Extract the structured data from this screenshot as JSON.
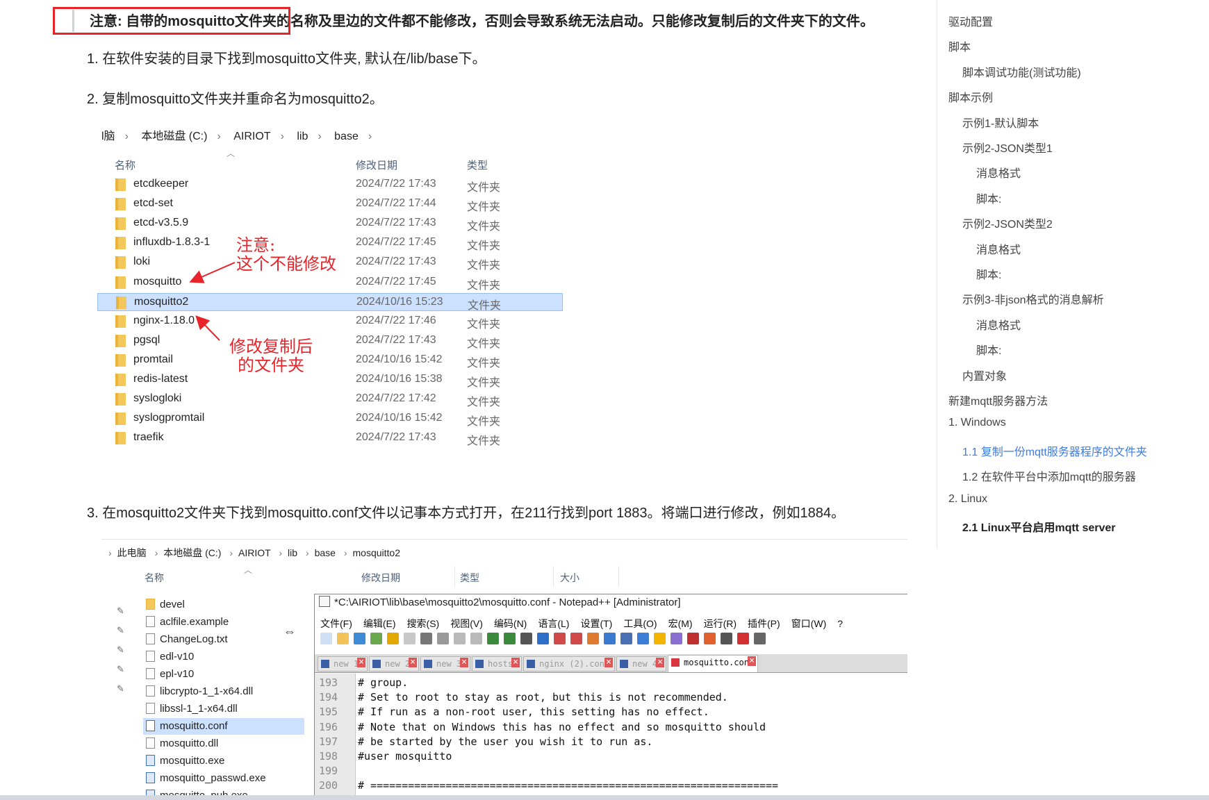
{
  "article": {
    "note": "注意: 自带的mosquitto文件夹的名称及里边的文件都不能修改，否则会导致系统无法启动。只能修改复制后的文件夹下的文件。",
    "step1": "1. 在软件安装的目录下找到mosquitto文件夹, 默认在/lib/base下。",
    "step2": "2. 复制mosquitto文件夹并重命名为mosquitto2。",
    "step3": "3. 在mosquitto2文件夹下找到mosquitto.conf文件以记事本方式打开，在211行找到port 1883。将端口进行修改，例如1884。"
  },
  "explorer1": {
    "breadcrumb": [
      "l脑",
      "本地磁盘 (C:)",
      "AIRIOT",
      "lib",
      "base"
    ],
    "headers": {
      "name": "名称",
      "date": "修改日期",
      "type": "类型"
    },
    "files": [
      {
        "name": "etcdkeeper",
        "date": "2024/7/22 17:43",
        "type": "文件夹"
      },
      {
        "name": "etcd-set",
        "date": "2024/7/22 17:44",
        "type": "文件夹"
      },
      {
        "name": "etcd-v3.5.9",
        "date": "2024/7/22 17:43",
        "type": "文件夹"
      },
      {
        "name": "influxdb-1.8.3-1",
        "date": "2024/7/22 17:45",
        "type": "文件夹"
      },
      {
        "name": "loki",
        "date": "2024/7/22 17:43",
        "type": "文件夹"
      },
      {
        "name": "mosquitto",
        "date": "2024/7/22 17:45",
        "type": "文件夹"
      },
      {
        "name": "mosquitto2",
        "date": "2024/10/16 15:23",
        "type": "文件夹"
      },
      {
        "name": "nginx-1.18.0",
        "date": "2024/7/22 17:46",
        "type": "文件夹"
      },
      {
        "name": "pgsql",
        "date": "2024/7/22 17:43",
        "type": "文件夹"
      },
      {
        "name": "promtail",
        "date": "2024/10/16 15:42",
        "type": "文件夹"
      },
      {
        "name": "redis-latest",
        "date": "2024/10/16 15:38",
        "type": "文件夹"
      },
      {
        "name": "syslogloki",
        "date": "2024/7/22 17:42",
        "type": "文件夹"
      },
      {
        "name": "syslogpromtail",
        "date": "2024/10/16 15:42",
        "type": "文件夹"
      },
      {
        "name": "traefik",
        "date": "2024/7/22 17:43",
        "type": "文件夹"
      }
    ],
    "annotation1": [
      "注意:",
      "这个不能修改"
    ],
    "annotation2": [
      "修改复制后",
      "的文件夹"
    ]
  },
  "explorer2": {
    "breadcrumb": [
      "此电脑",
      "本地磁盘 (C:)",
      "AIRIOT",
      "lib",
      "base",
      "mosquitto2"
    ],
    "headers": {
      "name": "名称",
      "date": "修改日期",
      "type": "类型",
      "size": "大小"
    },
    "files": [
      {
        "name": "devel",
        "icon": "folder-icon"
      },
      {
        "name": "aclfile.example",
        "icon": "file-icon"
      },
      {
        "name": "ChangeLog.txt",
        "icon": "text-file-icon"
      },
      {
        "name": "edl-v10",
        "icon": "file-icon"
      },
      {
        "name": "epl-v10",
        "icon": "file-icon"
      },
      {
        "name": "libcrypto-1_1-x64.dll",
        "icon": "dll-icon"
      },
      {
        "name": "libssl-1_1-x64.dll",
        "icon": "dll-icon"
      },
      {
        "name": "mosquitto.conf",
        "icon": "conf-icon"
      },
      {
        "name": "mosquitto.dll",
        "icon": "dll-icon"
      },
      {
        "name": "mosquitto.exe",
        "icon": "exe-icon"
      },
      {
        "name": "mosquitto_passwd.exe",
        "icon": "exe-icon"
      },
      {
        "name": "mosquitto_pub.exe",
        "icon": "exe-icon"
      }
    ]
  },
  "notepad": {
    "title": "*C:\\AIRIOT\\lib\\base\\mosquitto2\\mosquitto.conf - Notepad++ [Administrator]",
    "menu": [
      "文件(F)",
      "编辑(E)",
      "搜索(S)",
      "视图(V)",
      "编码(N)",
      "语言(L)",
      "设置(T)",
      "工具(O)",
      "宏(M)",
      "运行(R)",
      "插件(P)",
      "窗口(W)",
      "?"
    ],
    "tabs": [
      "new 1",
      "new 2",
      "new 3",
      "hosts",
      "nginx (2).conf",
      "new 4",
      "mosquitto.conf"
    ],
    "lines": [
      {
        "n": "193",
        "t": "# group."
      },
      {
        "n": "194",
        "t": "# Set to root to stay as root, but this is not recommended."
      },
      {
        "n": "195",
        "t": "# If run as a non-root user, this setting has no effect."
      },
      {
        "n": "196",
        "t": "# Note that on Windows this has no effect and so mosquitto should"
      },
      {
        "n": "197",
        "t": "# be started by the user you wish it to run as."
      },
      {
        "n": "198",
        "t": "#user mosquitto"
      },
      {
        "n": "199",
        "t": ""
      },
      {
        "n": "200",
        "t": "# ================================================================="
      }
    ]
  },
  "toc": [
    "驱动配置",
    "脚本",
    "脚本调试功能(测试功能)",
    "脚本示例",
    "示例1-默认脚本",
    "示例2-JSON类型1",
    "消息格式",
    "脚本:",
    "示例2-JSON类型2",
    "消息格式",
    "脚本:",
    "示例3-非json格式的消息解析",
    "消息格式",
    "脚本:",
    "内置对象",
    "新建mqtt服务器方法",
    "1. Windows",
    "1.1 复制一份mqtt服务器程序的文件夹",
    "1.2 在软件平台中添加mqtt的服务器",
    "2. Linux",
    "2.1 Linux平台启用mqtt server"
  ],
  "colors": {
    "accent": "#3d7be0",
    "annotation": "#e8242b",
    "selection": "#cce0ff"
  }
}
